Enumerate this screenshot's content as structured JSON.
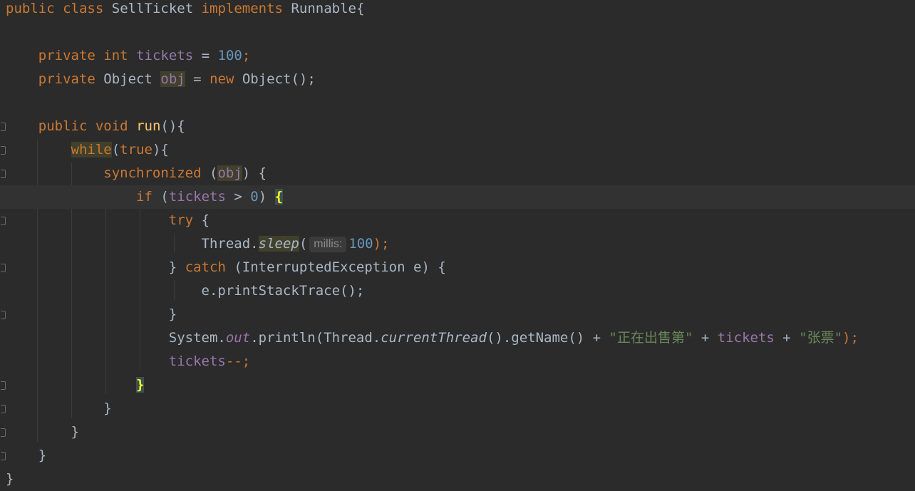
{
  "editor": {
    "file_language": "Java",
    "param_hint": "millis:",
    "lines": {
      "l1": {
        "t1": "public",
        "t2": "class",
        "t3": "SellTicket",
        "t4": "implements",
        "t5": "Runnable{"
      },
      "l3": {
        "t1": "private",
        "t2": "int",
        "t3": "tickets",
        "t4": "=",
        "t5": "100",
        "t6": ";"
      },
      "l4": {
        "t1": "private",
        "t2": "Object",
        "t3": "obj",
        "t4": "=",
        "t5": "new",
        "t6": "Object();"
      },
      "l6": {
        "t1": "public",
        "t2": "void",
        "t3": "run",
        "t4": "(){"
      },
      "l7": {
        "t1": "while",
        "t2": "(",
        "t3": "true",
        "t4": "){"
      },
      "l8": {
        "t1": "synchronized",
        "t2": "(",
        "t3": "obj",
        "t4": ") {"
      },
      "l9": {
        "t1": "if",
        "t2": "(",
        "t3": "tickets",
        "t4": "> ",
        "t5": "0",
        "t6": ") ",
        "t7": "{"
      },
      "l10": {
        "t1": "try",
        "t2": "{"
      },
      "l11": {
        "t1": "Thread.",
        "t2": "sleep",
        "t3": "(",
        "t4": "100",
        "t5": ");"
      },
      "l12": {
        "t1": "}",
        "t2": "catch",
        "t3": "(InterruptedException e) {"
      },
      "l13": {
        "t1": "e.printStackTrace();"
      },
      "l14": {
        "t1": "}"
      },
      "l15": {
        "t1": "System.",
        "t2": "out",
        "t3": ".println(Thread.",
        "t4": "currentThread",
        "t5": "().getName() + ",
        "t6": "\"正在出售第\"",
        "t7": " + ",
        "t8": "tickets",
        "t9": " + ",
        "t10": "\"张票\"",
        "t11": ");"
      },
      "l16": {
        "t1": "tickets",
        "t2": "--;"
      },
      "l17": {
        "t1": "}"
      },
      "l18": {
        "t1": "}"
      },
      "l19": {
        "t1": "}"
      },
      "l20": {
        "t1": "}"
      },
      "l21": {
        "t1": "}"
      }
    }
  }
}
